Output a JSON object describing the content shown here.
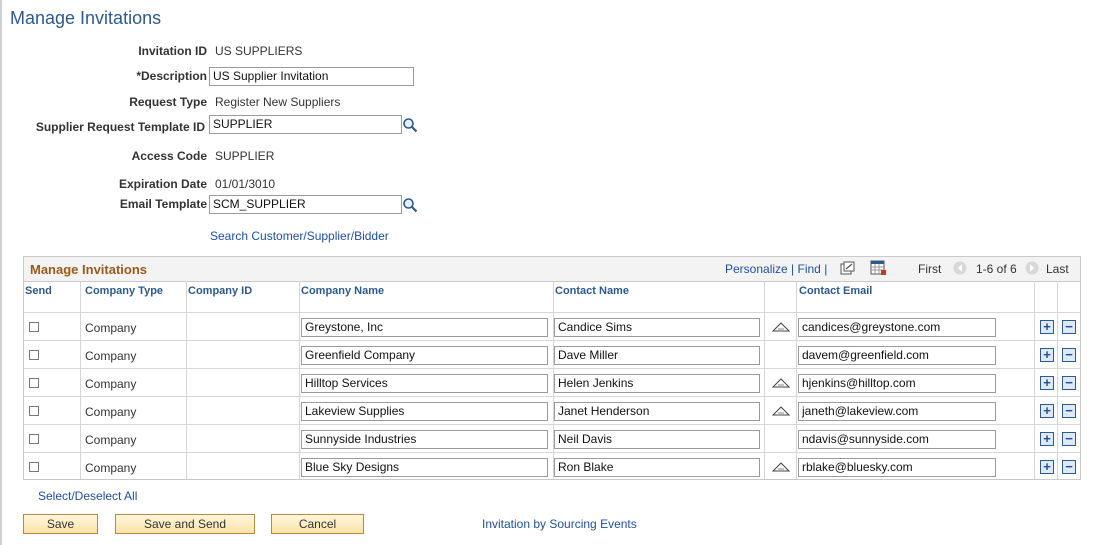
{
  "page": {
    "title": "Manage Invitations"
  },
  "form": {
    "invitation_id": {
      "label": "Invitation ID",
      "value": "US SUPPLIERS"
    },
    "description": {
      "label": "*Description",
      "value": "US Supplier Invitation"
    },
    "request_type": {
      "label": "Request Type",
      "value": "Register New Suppliers"
    },
    "template_id": {
      "label": "Supplier Request Template ID",
      "value": "SUPPLIER"
    },
    "access_code": {
      "label": "Access Code",
      "value": "SUPPLIER"
    },
    "expiration_date": {
      "label": "Expiration Date",
      "value": "01/01/3010"
    },
    "email_template": {
      "label": "Email Template",
      "value": "SCM_SUPPLIER"
    },
    "search_link": "Search Customer/Supplier/Bidder"
  },
  "grid": {
    "title": "Manage Invitations",
    "personalize": "Personalize",
    "find": "Find",
    "first": "First",
    "range": "1-6 of 6",
    "last": "Last",
    "columns": {
      "send": "Send",
      "company_type": "Company Type",
      "company_id": "Company ID",
      "company_name": "Company Name",
      "contact_name": "Contact Name",
      "contact_email": "Contact Email"
    },
    "rows": [
      {
        "type": "Company",
        "id": "",
        "name": "Greystone, Inc",
        "contact": "Candice Sims",
        "email": "candices@greystone.com",
        "address_icon": true
      },
      {
        "type": "Company",
        "id": "",
        "name": "Greenfield Company",
        "contact": "Dave Miller",
        "email": "davem@greenfield.com",
        "address_icon": false
      },
      {
        "type": "Company",
        "id": "",
        "name": "Hilltop Services",
        "contact": "Helen Jenkins",
        "email": "hjenkins@hilltop.com",
        "address_icon": true
      },
      {
        "type": "Company",
        "id": "",
        "name": "Lakeview Supplies",
        "contact": "Janet Henderson",
        "email": "janeth@lakeview.com",
        "address_icon": true
      },
      {
        "type": "Company",
        "id": "",
        "name": "Sunnyside Industries",
        "contact": "Neil Davis",
        "email": "ndavis@sunnyside.com",
        "address_icon": false
      },
      {
        "type": "Company",
        "id": "",
        "name": "Blue Sky Designs",
        "contact": "Ron Blake",
        "email": "rblake@bluesky.com",
        "address_icon": true
      }
    ],
    "add_symbol": "+",
    "remove_symbol": "−"
  },
  "select_all": "Select/Deselect All",
  "buttons": {
    "save": "Save",
    "save_send": "Save and Send",
    "cancel": "Cancel"
  },
  "footer_link": "Invitation by Sourcing Events",
  "icons": {
    "lookup": "magnifier-icon",
    "zoom": "view-all-icon",
    "download": "grid-download-icon",
    "prev": "previous-arrow-icon",
    "next": "next-arrow-icon",
    "address": "address-book-icon"
  },
  "colors": {
    "title": "#2d5a8c",
    "grid_title": "#9b5a1a",
    "link": "#1f4f9c",
    "button_bg": "#fbe3a8"
  }
}
